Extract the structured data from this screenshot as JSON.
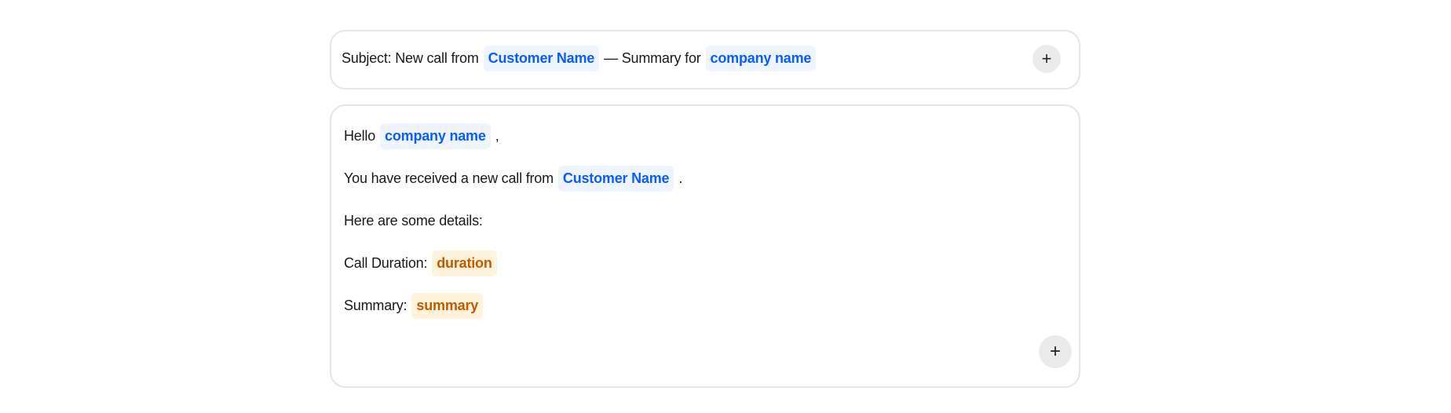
{
  "subject": {
    "prefix": "Subject: New call from",
    "var1": "Customer Name",
    "middle": "— Summary for",
    "var2": "company name",
    "add_icon": "+"
  },
  "body": {
    "line1": {
      "text": "Hello",
      "var": "company name",
      "suffix": ","
    },
    "line2": {
      "text": "You have received a new call from",
      "var": "Customer Name",
      "suffix": "."
    },
    "line3": {
      "text": "Here are some details:"
    },
    "line4": {
      "text": "Call Duration:",
      "var": "duration"
    },
    "line5": {
      "text": "Summary:",
      "var": "summary"
    },
    "add_icon": "+"
  }
}
